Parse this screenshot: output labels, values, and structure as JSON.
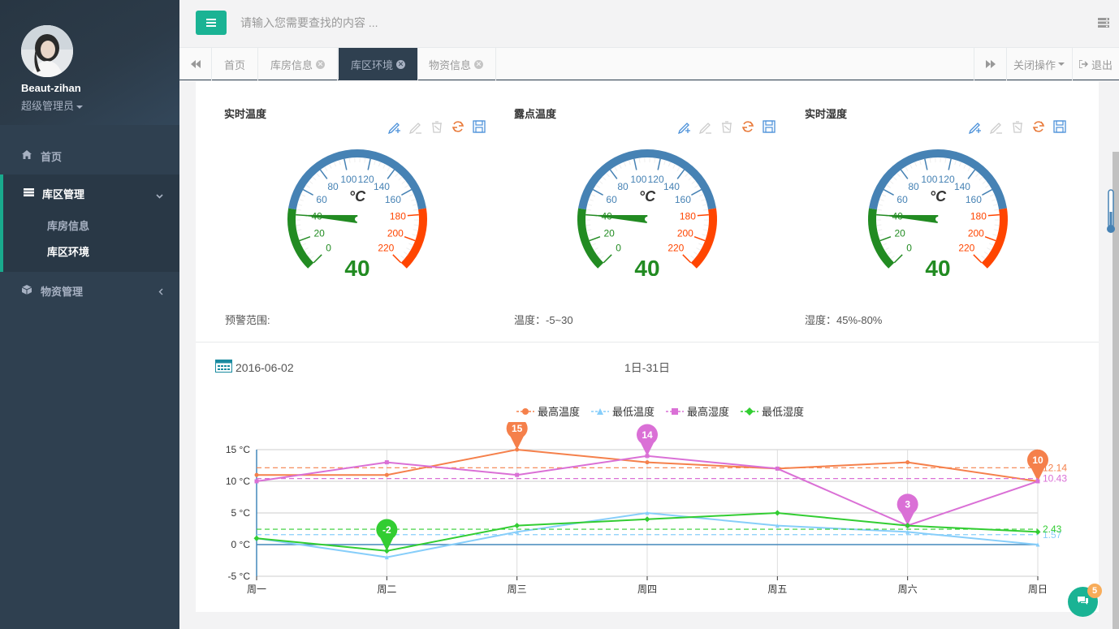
{
  "user": {
    "name": "Beaut-zihan",
    "role": "超级管理员"
  },
  "nav": {
    "home": "首页",
    "warehouse": "库区管理",
    "warehouse_info": "库房信息",
    "warehouse_env": "库区环境",
    "materials": "物资管理"
  },
  "topbar": {
    "search_placeholder": "请输入您需要查找的内容 ..."
  },
  "tabs": {
    "home": "首页",
    "items": [
      "库房信息",
      "库区环境",
      "物资信息"
    ],
    "active": "库区环境",
    "close_ops": "关闭操作",
    "logout": "退出"
  },
  "gauges": [
    {
      "title": "实时温度",
      "unit": "°C",
      "value": 40,
      "warning": "预警范围:"
    },
    {
      "title": "露点温度",
      "unit": "°C",
      "value": 40,
      "warning": "温度：-5~30"
    },
    {
      "title": "实时湿度",
      "unit": "°C",
      "value": 40,
      "warning": "湿度：45%-80%"
    }
  ],
  "gauge_ticks": [
    "0",
    "20",
    "40",
    "60",
    "80",
    "100",
    "120",
    "140",
    "160",
    "180",
    "200",
    "220"
  ],
  "date": "2016-06-02",
  "range_label": "1日-31日",
  "notification_count": "5",
  "colors": {
    "accent": "#1ab394",
    "sidebar": "#2f4050",
    "gauge_blue": "#4682b4",
    "gauge_green": "#228b22",
    "gauge_red": "#ff4500"
  },
  "chart_data": {
    "type": "line",
    "categories": [
      "周一",
      "周二",
      "周三",
      "周四",
      "周五",
      "周六",
      "周日"
    ],
    "ylim": [
      -5,
      15
    ],
    "yticks": [
      "15 °C",
      "10 °C",
      "5 °C",
      "0 °C",
      "-5 °C"
    ],
    "series": [
      {
        "name": "最高温度",
        "color": "#f5804b",
        "marker": "circle",
        "values": [
          11,
          11,
          15,
          13,
          12,
          13,
          10
        ],
        "avg": "12.14",
        "avg_value": 12.14,
        "pins": [
          {
            "index": 2,
            "label": "15"
          },
          {
            "index": 6,
            "label": "10"
          }
        ]
      },
      {
        "name": "最低温度",
        "color": "#87cefa",
        "marker": "triangle",
        "values": [
          1,
          -2,
          2,
          5,
          3,
          2,
          0
        ],
        "avg": "1.57",
        "avg_value": 1.57,
        "pins": []
      },
      {
        "name": "最高湿度",
        "color": "#da70d6",
        "marker": "square",
        "values": [
          10,
          13,
          11,
          14,
          12,
          3,
          10
        ],
        "avg": "10.43",
        "avg_value": 10.43,
        "pins": [
          {
            "index": 3,
            "label": "14"
          },
          {
            "index": 5,
            "label": "3"
          }
        ]
      },
      {
        "name": "最低湿度",
        "color": "#32cd32",
        "marker": "diamond",
        "values": [
          1,
          -1,
          3,
          4,
          5,
          3,
          2
        ],
        "avg": "2.43",
        "avg_value": 2.43,
        "pins": [
          {
            "index": 1,
            "label": "-2"
          }
        ]
      }
    ]
  }
}
